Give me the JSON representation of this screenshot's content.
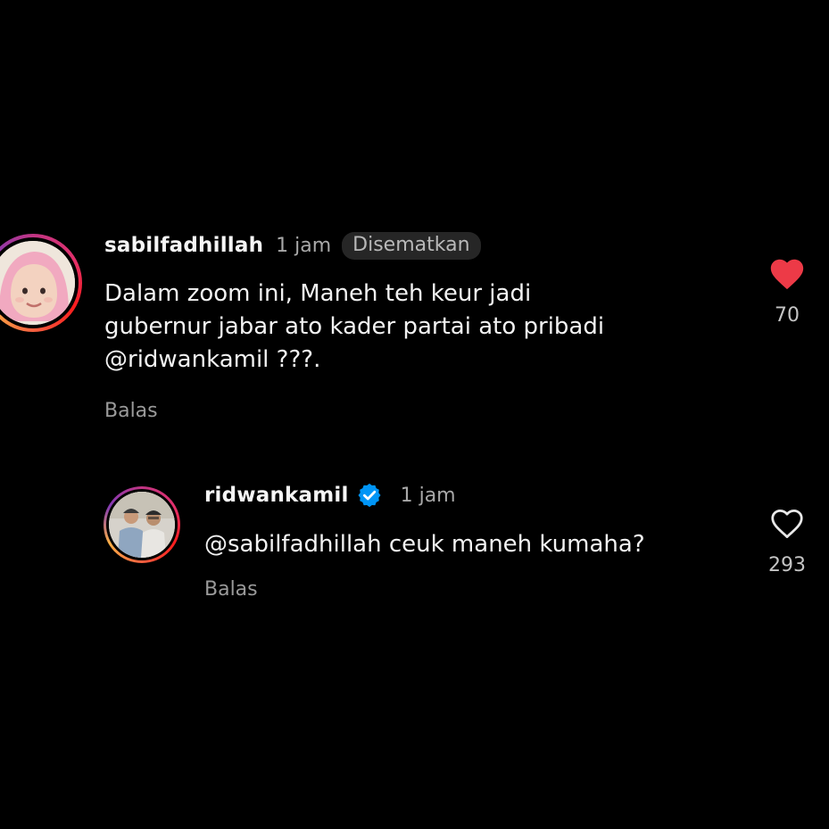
{
  "comments": [
    {
      "username": "sabilfadhillah",
      "time": "1 jam",
      "badge": "Disematkan",
      "text_lines": [
        "Dalam zoom ini, Maneh teh keur jadi",
        "gubernur jabar ato kader partai ato pribadi",
        "@ridwankamil ???."
      ],
      "reply_label": "Balas",
      "like_count": "70",
      "liked": true
    },
    {
      "username": "ridwankamil",
      "verified": true,
      "time": "1 jam",
      "text_lines": [
        "@sabilfadhillah ceuk maneh kumaha?"
      ],
      "reply_label": "Balas",
      "like_count": "293",
      "liked": false
    }
  ],
  "colors": {
    "background": "#000000",
    "like_red": "#ed3a47",
    "verified_blue": "#0095f6",
    "muted_text": "#a8a8a8"
  },
  "icons": {
    "like_filled": "heart-filled-icon",
    "like_outline": "heart-outline-icon",
    "verified": "verified-badge-icon"
  }
}
